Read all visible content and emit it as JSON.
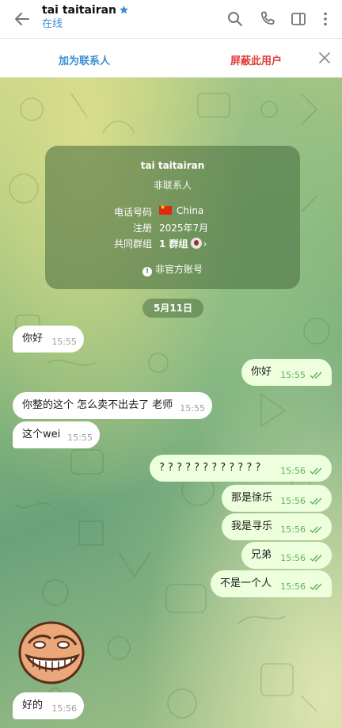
{
  "header": {
    "title": "tai taitairan",
    "status": "在线",
    "icons": [
      "back-arrow-icon",
      "star-icon",
      "search-icon",
      "phone-icon",
      "sidebar-toggle-icon",
      "more-vertical-icon"
    ]
  },
  "actionbar": {
    "add_contact": "加为联系人",
    "block_user": "屏蔽此用户"
  },
  "info": {
    "name": "tai taitairan",
    "subtitle": "非联系人",
    "phone_label": "电话号码",
    "phone_value": "China",
    "registered_label": "注册",
    "registered_value": "2025年7月",
    "groups_label": "共同群组",
    "groups_value": "1 群组",
    "unofficial": "非官方账号"
  },
  "date_pill": "5月11日",
  "messages": [
    {
      "dir": "in",
      "text": "你好",
      "time": "15:55"
    },
    {
      "dir": "out",
      "text": "你好",
      "time": "15:55"
    },
    {
      "dir": "in",
      "text": "你整的这个 怎么卖不出去了 老师",
      "time": "15:55"
    },
    {
      "dir": "in",
      "text": "这个wei",
      "time": "15:55"
    },
    {
      "dir": "out",
      "text": "? ? ? ? ? ? ? ? ? ? ? ?",
      "time": "15:56"
    },
    {
      "dir": "out",
      "text": "那是徐乐",
      "time": "15:56"
    },
    {
      "dir": "out",
      "text": "我是寻乐",
      "time": "15:56"
    },
    {
      "dir": "out",
      "text": "兄弟",
      "time": "15:56"
    },
    {
      "dir": "out",
      "text": "不是一个人",
      "time": "15:56"
    },
    {
      "dir": "in",
      "text": "好的",
      "time": "15:56"
    }
  ],
  "colors": {
    "accent_blue": "#3a8fd4",
    "danger_red": "#e0403c",
    "outgoing_bubble": "#eeffde",
    "incoming_bubble": "#ffffff",
    "read_tick": "#5fb05a"
  }
}
